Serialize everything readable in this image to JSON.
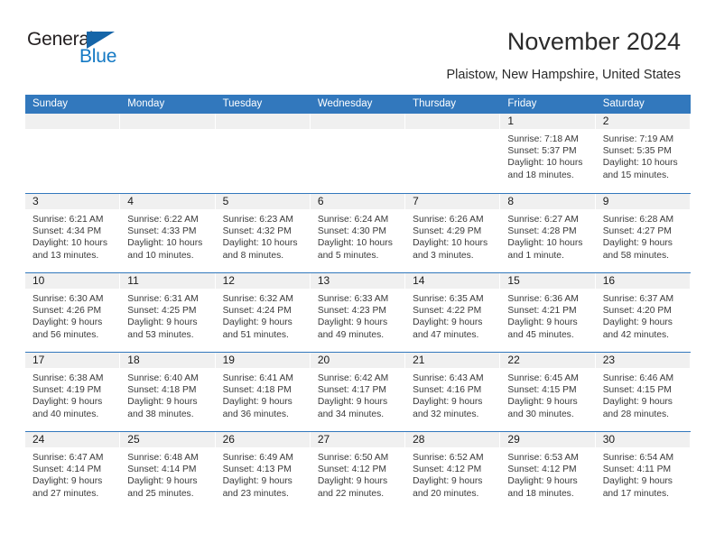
{
  "brand": {
    "name_part1": "General",
    "name_part2": "Blue",
    "triangle_color": "#1565a8",
    "blue_text_color": "#1479c4"
  },
  "header": {
    "title": "November 2024",
    "subtitle": "Plaistow, New Hampshire, United States"
  },
  "theme": {
    "header_blue": "#3278bd",
    "daynum_gray": "#f0f0f0",
    "text_color": "#1a1a1a",
    "detail_text_color": "#3a3a3a"
  },
  "weekdays": [
    "Sunday",
    "Monday",
    "Tuesday",
    "Wednesday",
    "Thursday",
    "Friday",
    "Saturday"
  ],
  "weeks": [
    [
      {
        "day": "",
        "empty": true
      },
      {
        "day": "",
        "empty": true
      },
      {
        "day": "",
        "empty": true
      },
      {
        "day": "",
        "empty": true
      },
      {
        "day": "",
        "empty": true
      },
      {
        "day": "1",
        "sunrise": "Sunrise: 7:18 AM",
        "sunset": "Sunset: 5:37 PM",
        "daylight_1": "Daylight: 10 hours",
        "daylight_2": "and 18 minutes."
      },
      {
        "day": "2",
        "sunrise": "Sunrise: 7:19 AM",
        "sunset": "Sunset: 5:35 PM",
        "daylight_1": "Daylight: 10 hours",
        "daylight_2": "and 15 minutes."
      }
    ],
    [
      {
        "day": "3",
        "sunrise": "Sunrise: 6:21 AM",
        "sunset": "Sunset: 4:34 PM",
        "daylight_1": "Daylight: 10 hours",
        "daylight_2": "and 13 minutes."
      },
      {
        "day": "4",
        "sunrise": "Sunrise: 6:22 AM",
        "sunset": "Sunset: 4:33 PM",
        "daylight_1": "Daylight: 10 hours",
        "daylight_2": "and 10 minutes."
      },
      {
        "day": "5",
        "sunrise": "Sunrise: 6:23 AM",
        "sunset": "Sunset: 4:32 PM",
        "daylight_1": "Daylight: 10 hours",
        "daylight_2": "and 8 minutes."
      },
      {
        "day": "6",
        "sunrise": "Sunrise: 6:24 AM",
        "sunset": "Sunset: 4:30 PM",
        "daylight_1": "Daylight: 10 hours",
        "daylight_2": "and 5 minutes."
      },
      {
        "day": "7",
        "sunrise": "Sunrise: 6:26 AM",
        "sunset": "Sunset: 4:29 PM",
        "daylight_1": "Daylight: 10 hours",
        "daylight_2": "and 3 minutes."
      },
      {
        "day": "8",
        "sunrise": "Sunrise: 6:27 AM",
        "sunset": "Sunset: 4:28 PM",
        "daylight_1": "Daylight: 10 hours",
        "daylight_2": "and 1 minute."
      },
      {
        "day": "9",
        "sunrise": "Sunrise: 6:28 AM",
        "sunset": "Sunset: 4:27 PM",
        "daylight_1": "Daylight: 9 hours",
        "daylight_2": "and 58 minutes."
      }
    ],
    [
      {
        "day": "10",
        "sunrise": "Sunrise: 6:30 AM",
        "sunset": "Sunset: 4:26 PM",
        "daylight_1": "Daylight: 9 hours",
        "daylight_2": "and 56 minutes."
      },
      {
        "day": "11",
        "sunrise": "Sunrise: 6:31 AM",
        "sunset": "Sunset: 4:25 PM",
        "daylight_1": "Daylight: 9 hours",
        "daylight_2": "and 53 minutes."
      },
      {
        "day": "12",
        "sunrise": "Sunrise: 6:32 AM",
        "sunset": "Sunset: 4:24 PM",
        "daylight_1": "Daylight: 9 hours",
        "daylight_2": "and 51 minutes."
      },
      {
        "day": "13",
        "sunrise": "Sunrise: 6:33 AM",
        "sunset": "Sunset: 4:23 PM",
        "daylight_1": "Daylight: 9 hours",
        "daylight_2": "and 49 minutes."
      },
      {
        "day": "14",
        "sunrise": "Sunrise: 6:35 AM",
        "sunset": "Sunset: 4:22 PM",
        "daylight_1": "Daylight: 9 hours",
        "daylight_2": "and 47 minutes."
      },
      {
        "day": "15",
        "sunrise": "Sunrise: 6:36 AM",
        "sunset": "Sunset: 4:21 PM",
        "daylight_1": "Daylight: 9 hours",
        "daylight_2": "and 45 minutes."
      },
      {
        "day": "16",
        "sunrise": "Sunrise: 6:37 AM",
        "sunset": "Sunset: 4:20 PM",
        "daylight_1": "Daylight: 9 hours",
        "daylight_2": "and 42 minutes."
      }
    ],
    [
      {
        "day": "17",
        "sunrise": "Sunrise: 6:38 AM",
        "sunset": "Sunset: 4:19 PM",
        "daylight_1": "Daylight: 9 hours",
        "daylight_2": "and 40 minutes."
      },
      {
        "day": "18",
        "sunrise": "Sunrise: 6:40 AM",
        "sunset": "Sunset: 4:18 PM",
        "daylight_1": "Daylight: 9 hours",
        "daylight_2": "and 38 minutes."
      },
      {
        "day": "19",
        "sunrise": "Sunrise: 6:41 AM",
        "sunset": "Sunset: 4:18 PM",
        "daylight_1": "Daylight: 9 hours",
        "daylight_2": "and 36 minutes."
      },
      {
        "day": "20",
        "sunrise": "Sunrise: 6:42 AM",
        "sunset": "Sunset: 4:17 PM",
        "daylight_1": "Daylight: 9 hours",
        "daylight_2": "and 34 minutes."
      },
      {
        "day": "21",
        "sunrise": "Sunrise: 6:43 AM",
        "sunset": "Sunset: 4:16 PM",
        "daylight_1": "Daylight: 9 hours",
        "daylight_2": "and 32 minutes."
      },
      {
        "day": "22",
        "sunrise": "Sunrise: 6:45 AM",
        "sunset": "Sunset: 4:15 PM",
        "daylight_1": "Daylight: 9 hours",
        "daylight_2": "and 30 minutes."
      },
      {
        "day": "23",
        "sunrise": "Sunrise: 6:46 AM",
        "sunset": "Sunset: 4:15 PM",
        "daylight_1": "Daylight: 9 hours",
        "daylight_2": "and 28 minutes."
      }
    ],
    [
      {
        "day": "24",
        "sunrise": "Sunrise: 6:47 AM",
        "sunset": "Sunset: 4:14 PM",
        "daylight_1": "Daylight: 9 hours",
        "daylight_2": "and 27 minutes."
      },
      {
        "day": "25",
        "sunrise": "Sunrise: 6:48 AM",
        "sunset": "Sunset: 4:14 PM",
        "daylight_1": "Daylight: 9 hours",
        "daylight_2": "and 25 minutes."
      },
      {
        "day": "26",
        "sunrise": "Sunrise: 6:49 AM",
        "sunset": "Sunset: 4:13 PM",
        "daylight_1": "Daylight: 9 hours",
        "daylight_2": "and 23 minutes."
      },
      {
        "day": "27",
        "sunrise": "Sunrise: 6:50 AM",
        "sunset": "Sunset: 4:12 PM",
        "daylight_1": "Daylight: 9 hours",
        "daylight_2": "and 22 minutes."
      },
      {
        "day": "28",
        "sunrise": "Sunrise: 6:52 AM",
        "sunset": "Sunset: 4:12 PM",
        "daylight_1": "Daylight: 9 hours",
        "daylight_2": "and 20 minutes."
      },
      {
        "day": "29",
        "sunrise": "Sunrise: 6:53 AM",
        "sunset": "Sunset: 4:12 PM",
        "daylight_1": "Daylight: 9 hours",
        "daylight_2": "and 18 minutes."
      },
      {
        "day": "30",
        "sunrise": "Sunrise: 6:54 AM",
        "sunset": "Sunset: 4:11 PM",
        "daylight_1": "Daylight: 9 hours",
        "daylight_2": "and 17 minutes."
      }
    ]
  ]
}
